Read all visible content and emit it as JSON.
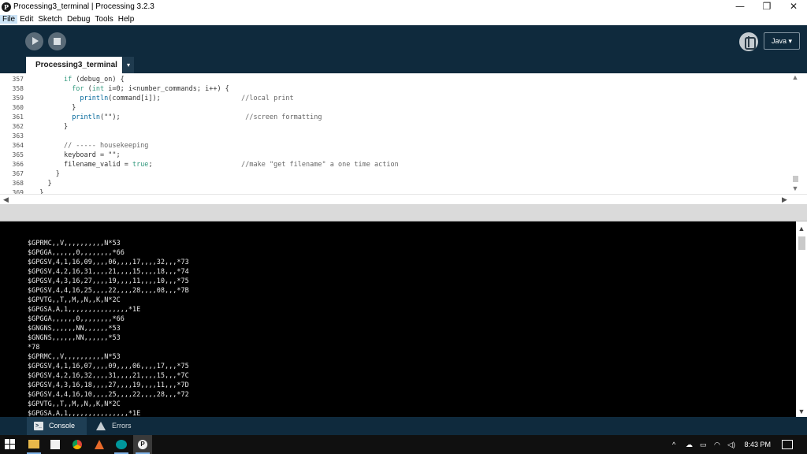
{
  "window": {
    "title": "Processing3_terminal | Processing 3.2.3",
    "controls": {
      "minimize": "—",
      "restore": "❐",
      "close": "✕"
    }
  },
  "menu": [
    "File",
    "Edit",
    "Sketch",
    "Debug",
    "Tools",
    "Help"
  ],
  "toolbar": {
    "mode": "Java ▾"
  },
  "tab": {
    "name": "Processing3_terminal",
    "menu_arrow": "▾"
  },
  "editor": {
    "lines": [
      {
        "num": "357",
        "indent": "        ",
        "parts": [
          {
            "t": "if",
            "c": "kw"
          },
          {
            "t": " (debug_on) {",
            "c": ""
          }
        ]
      },
      {
        "num": "358",
        "indent": "          ",
        "parts": [
          {
            "t": "for",
            "c": "kw"
          },
          {
            "t": " (",
            "c": ""
          },
          {
            "t": "int",
            "c": "kw"
          },
          {
            "t": " i=0; i<number_commands; i++) {",
            "c": ""
          }
        ]
      },
      {
        "num": "359",
        "indent": "            ",
        "parts": [
          {
            "t": "println",
            "c": "fn"
          },
          {
            "t": "(command[i]);                    ",
            "c": ""
          },
          {
            "t": "//local print",
            "c": "cm"
          }
        ]
      },
      {
        "num": "360",
        "indent": "          ",
        "parts": [
          {
            "t": "}",
            "c": ""
          }
        ]
      },
      {
        "num": "361",
        "indent": "          ",
        "parts": [
          {
            "t": "println",
            "c": "fn"
          },
          {
            "t": "(\"\");                               ",
            "c": ""
          },
          {
            "t": "//screen formatting",
            "c": "cm"
          }
        ]
      },
      {
        "num": "362",
        "indent": "        ",
        "parts": [
          {
            "t": "}",
            "c": ""
          }
        ]
      },
      {
        "num": "363",
        "indent": "",
        "parts": []
      },
      {
        "num": "364",
        "indent": "        ",
        "parts": [
          {
            "t": "// ----- housekeeping",
            "c": "cm"
          }
        ]
      },
      {
        "num": "365",
        "indent": "        ",
        "parts": [
          {
            "t": "keyboard = \"\";",
            "c": ""
          }
        ]
      },
      {
        "num": "366",
        "indent": "        ",
        "parts": [
          {
            "t": "filename_valid = ",
            "c": ""
          },
          {
            "t": "true",
            "c": "kw"
          },
          {
            "t": ";                      ",
            "c": ""
          },
          {
            "t": "//make \"get filename\" a one time action",
            "c": "cm"
          }
        ]
      },
      {
        "num": "367",
        "indent": "      ",
        "parts": [
          {
            "t": "}",
            "c": ""
          }
        ]
      },
      {
        "num": "368",
        "indent": "    ",
        "parts": [
          {
            "t": "}",
            "c": ""
          }
        ]
      },
      {
        "num": "369",
        "indent": "  ",
        "parts": [
          {
            "t": "}",
            "c": ""
          }
        ]
      }
    ]
  },
  "console": {
    "lines": [
      "$GPRMC,,V,,,,,,,,,,N*53",
      "$GPGGA,,,,,,0,,,,,,,,*66",
      "$GPGSV,4,1,16,09,,,,06,,,,17,,,,32,,,*73",
      "$GPGSV,4,2,16,31,,,,21,,,,15,,,,18,,,*74",
      "$GPGSV,4,3,16,27,,,,19,,,,11,,,,10,,,*75",
      "$GPGSV,4,4,16,25,,,,22,,,,28,,,,08,,,*7B",
      "$GPVTG,,T,,M,,N,,K,N*2C",
      "$GPGSA,A,1,,,,,,,,,,,,,,,*1E",
      "$GPGGA,,,,,,0,,,,,,,,*66",
      "$GNGNS,,,,,,NN,,,,,,*53",
      "$GNGNS,,,,,,NN,,,,,,*53",
      "*78",
      "$GPRMC,,V,,,,,,,,,,N*53",
      "$GPGSV,4,1,16,07,,,,09,,,,06,,,,17,,,*75",
      "$GPGSV,4,2,16,32,,,,31,,,,21,,,,15,,,*7C",
      "$GPGSV,4,3,16,18,,,,27,,,,19,,,,11,,,*7D",
      "$GPGSV,4,4,16,10,,,,25,,,,22,,,,28,,,*72",
      "$GPVTG,,T,,M,,N,,K,N*2C",
      "$GPGSA,A,1,,,,,,,,,,,,,,,*1E"
    ]
  },
  "status_tabs": {
    "console": "Console",
    "errors": "Errors"
  },
  "taskbar": {
    "time": "8:43 PM"
  },
  "colors": {
    "toolbar_bg": "#0f2a3d",
    "keyword": "#33997e",
    "function": "#006699",
    "comment": "#666666"
  },
  "icons": [
    "processing-logo-icon",
    "run-icon",
    "stop-icon",
    "debug-icon",
    "console-icon",
    "warning-icon",
    "windows-start-icon"
  ]
}
